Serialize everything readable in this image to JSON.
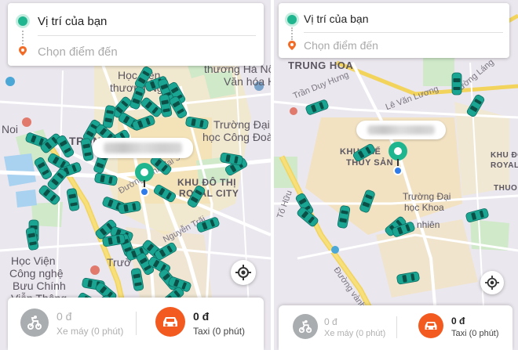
{
  "colors": {
    "accent_green": "#1fb58f",
    "car_teal": "#1aa593",
    "dest_orange": "#f26c27",
    "taxi_orange": "#f35a1f",
    "moto_gray": "#a9adb0"
  },
  "left": {
    "origin_label": "Vị trí của bạn",
    "destination_placeholder": "Chọn điểm đến",
    "map_labels": {
      "noi_bai": "Noi",
      "hoc_vien_top": "Học viện",
      "thuong_ngoai": "thương Ngoại",
      "thuong_ha_noi": "thương Hà Nội",
      "van_hoa": "Văn hóa Hà Nội",
      "truong_dai_hoc": "Trường Đại",
      "hoc_cong_doan": "học Công Đoàn",
      "trung": "TRUNG",
      "khu_do_thi": "KHU ĐÔ THỊ",
      "royal_city": "ROYAL CITY",
      "duong_vanh_dai": "Đường vành đai 3",
      "nguyen_trai": "Nguyễn Trãi",
      "hoc_vien_cn": "Học Viện",
      "cong_nghe": "Công nghệ",
      "buu_chinh": "Bưu Chính",
      "vien_thong": "Viễn Thông",
      "truong_bottom": "Trườ"
    },
    "moto": {
      "price": "0 đ",
      "label": "Xe máy (0 phút)"
    },
    "taxi": {
      "price": "0 đ",
      "label": "Taxi (0 phút)"
    }
  },
  "right": {
    "origin_label": "Vị trí của bạn",
    "destination_placeholder": "Chọn điểm đến",
    "map_labels": {
      "trung_hoa": "TRUNG HOA",
      "tran_duy_hung": "Trần Duy Hưng",
      "le_van_luong": "Lê Văn Lương",
      "khu_the": "KHU THỂ",
      "thuy_san": "THỦY SẢN",
      "khu_do": "KHU ĐÔ",
      "royal_cl": "ROYAL CI",
      "thuon": "THUON",
      "truong_dai_hoc": "Trường Đại",
      "hoc_khoa": "học Khoa",
      "nhien": "nhiên",
      "duong_vanh_dai": "Đường vành đai 3",
      "to_huu": "Tố Hữu",
      "duong_lang": "Đường Láng"
    },
    "moto": {
      "price": "0 đ",
      "label": "Xe máy (0 phút)"
    },
    "taxi": {
      "price": "0 đ",
      "label": "Taxi (0 phút)"
    }
  }
}
